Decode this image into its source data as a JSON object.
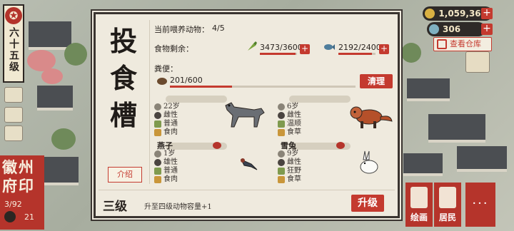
{
  "hud": {
    "level_text": "六十五级",
    "compass_glyph": "✪",
    "city": {
      "name": "徽州府印",
      "progress": "3/92",
      "count": "21"
    },
    "coins": "1,059,369",
    "jade": "306",
    "warehouse_label": "查看仓库",
    "bottom_buttons": [
      {
        "label": "绘画"
      },
      {
        "label": "居民"
      },
      {
        "label": "···"
      }
    ]
  },
  "modal": {
    "title": "投食槽",
    "intro_label": "介绍",
    "animals_label": "当前喂养动物：",
    "animals_value": "4/5",
    "food_label": "食物剩余：",
    "food": [
      {
        "icon": "vegetable-icon",
        "value": "3473/3600",
        "fill": 0.965
      },
      {
        "icon": "fish-icon",
        "value": "2192/2400",
        "fill": 0.913
      }
    ],
    "manure_label": "粪便：",
    "manure_value": "201/600",
    "manure_fill": 0.335,
    "clean_label": "清理",
    "animals": [
      {
        "name": "",
        "age": "22岁",
        "sex": "雌性",
        "mood": "普通",
        "diet": "食肉",
        "art": "greyhound"
      },
      {
        "name": "",
        "age": "6岁",
        "sex": "雌性",
        "mood": "温顺",
        "diet": "食草",
        "art": "red-panda"
      },
      {
        "name": "燕子",
        "age": "1岁",
        "sex": "雄性",
        "mood": "普通",
        "diet": "食肉",
        "art": "swallow"
      },
      {
        "name": "雪兔",
        "age": "9岁",
        "sex": "雌性",
        "mood": "狂野",
        "diet": "食草",
        "art": "snow-hare"
      }
    ],
    "upgrade_level": "三级",
    "upgrade_desc": "升至四级动物容量+1",
    "upgrade_label": "升级"
  }
}
